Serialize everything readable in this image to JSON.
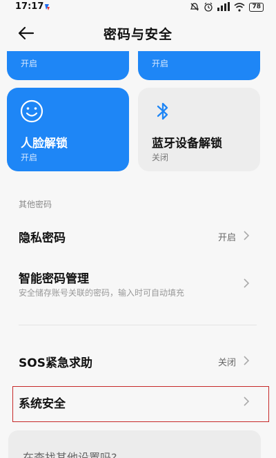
{
  "status_bar": {
    "time": "17:17",
    "battery": "78"
  },
  "header": {
    "title": "密码与安全"
  },
  "tiles": {
    "top_left": {
      "status": "开启"
    },
    "top_right": {
      "status": "开启"
    },
    "face": {
      "title": "人脸解锁",
      "status": "开启",
      "icon": "smiley-face-icon"
    },
    "bluetooth": {
      "title": "蓝牙设备解锁",
      "status": "关闭",
      "icon": "bluetooth-icon"
    }
  },
  "section": {
    "label": "其他密码"
  },
  "rows": {
    "privacy": {
      "title": "隐私密码",
      "value": "开启"
    },
    "smart": {
      "title": "智能密码管理",
      "subtitle": "安全储存账号关联的密码，输入时可自动填充"
    },
    "sos": {
      "title": "SOS紧急求助",
      "value": "关闭"
    },
    "system": {
      "title": "系统安全"
    }
  },
  "more": {
    "text": "在查找其他设置吗?"
  },
  "colors": {
    "accent": "#1e86f6",
    "highlight_border": "#c62828"
  }
}
